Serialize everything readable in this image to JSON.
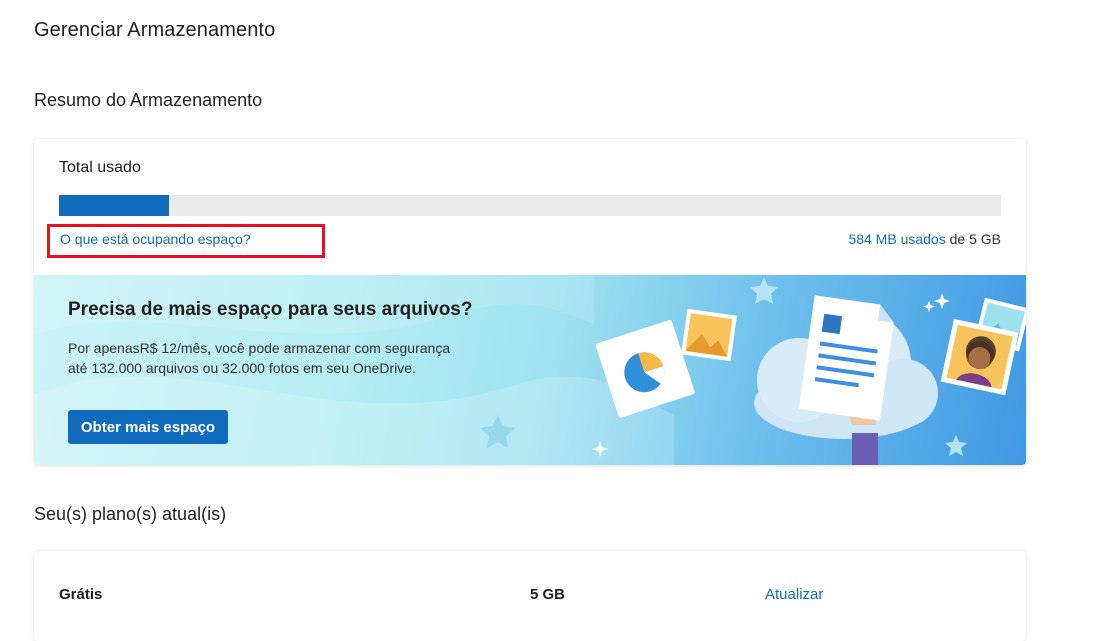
{
  "page": {
    "title": "Gerenciar Armazenamento"
  },
  "summary": {
    "section_title": "Resumo do Armazenamento",
    "total_label": "Total usado",
    "progress_fraction": 0.1168,
    "what_link": "O que está ocupando espaço?",
    "used_value": "584 MB usados",
    "total_text": " de 5 GB"
  },
  "promo": {
    "heading": "Precisa de mais espaço para seus arquivos?",
    "body": "Por apenasR$ 12/mês, você pode armazenar com segurança até 132.000 arquivos ou 32.000 fotos em seu OneDrive.",
    "button_label": "Obter mais espaço"
  },
  "plans": {
    "section_title": "Seu(s) plano(s) atual(is)",
    "rows": [
      {
        "name": "Grátis",
        "size": "5 GB",
        "action": "Atualizar"
      }
    ]
  },
  "colors": {
    "accent": "#0f6cbd",
    "link": "#106ebe",
    "highlight": "#e81123",
    "track": "#ebebeb"
  },
  "icons": [
    "star-icon",
    "sparkle-icon",
    "cloud-icon",
    "document-icon",
    "photo-icon",
    "pie-chart-icon",
    "avatar-photo-icon"
  ]
}
